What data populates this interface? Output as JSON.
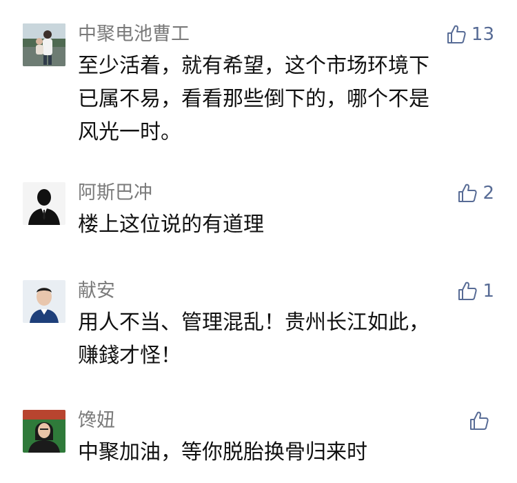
{
  "comments": [
    {
      "nickname": "中聚电池曹工",
      "likes": "13",
      "text": "至少活着，就有希望，这个市场环境下\n已属不易，看看那些倒下的，哪个不是\n风光一时。",
      "avatar": "user-photo-avatar"
    },
    {
      "nickname": "阿斯巴冲",
      "likes": "2",
      "text": "楼上这位说的有道理",
      "avatar": "silhouette-avatar"
    },
    {
      "nickname": "献安",
      "likes": "1",
      "text": "用人不当、管理混乱！贵州长江如此，\n赚錢才怪！",
      "avatar": "user-photo-avatar"
    },
    {
      "nickname": "馋妞",
      "likes": "",
      "text": "中聚加油，等你脱胎换骨归来时",
      "avatar": "user-photo-avatar"
    }
  ],
  "like_icon": "thumbs-up-icon",
  "accent_color": "#576b95"
}
